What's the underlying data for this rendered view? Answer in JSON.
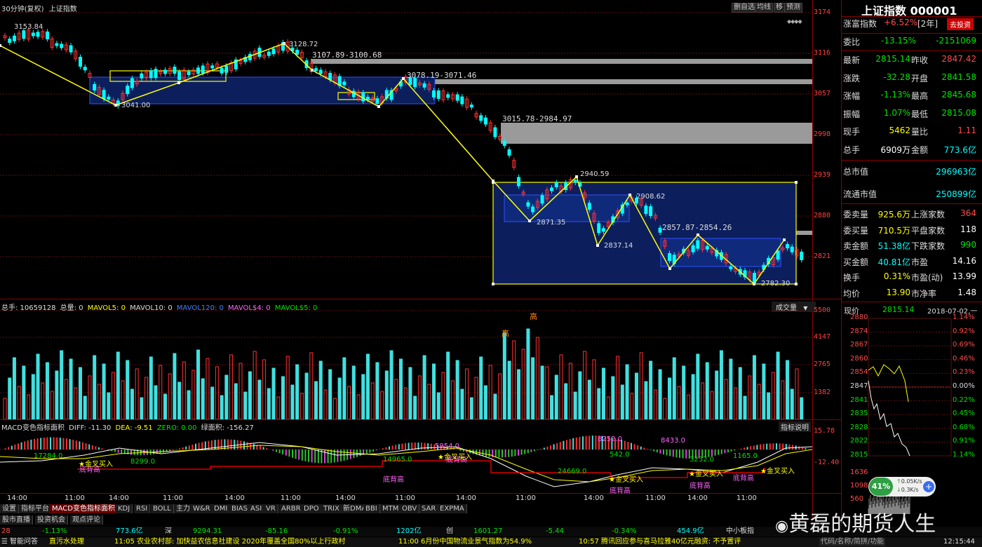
{
  "window": {
    "title_left": "30分钟(复权)",
    "title_index": "上证指数"
  },
  "toolbar": {
    "b1": "删自选",
    "b2": "均线",
    "b3": "移",
    "b4": "预测"
  },
  "price_axis": [
    "3174",
    "3116",
    "3057",
    "2998",
    "2939",
    "2880",
    "2821"
  ],
  "vol_axis": [
    "5500",
    "4147",
    "2765",
    "1382"
  ],
  "macd_axis": [
    "15.78",
    "-12.40"
  ],
  "time_axis": [
    "14:00",
    "11:00",
    "14:00",
    "11:00",
    "14:00",
    "11:00",
    "14:00",
    "11:00",
    "14:00",
    "11:00",
    "14:00",
    "11:00",
    "14:00",
    "11:00"
  ],
  "annotations": {
    "a1": "3153.84",
    "a2": "3041.00",
    "a3": "3128.72",
    "a4": "3107.89-3100.68",
    "a5": "3078.19-3071.46",
    "a6": "3015.78-2984.97",
    "a7": "2940.59",
    "a8": "2871.35",
    "a9": "2908.62",
    "a10": "2837.14",
    "a11": "2857.87-2854.26",
    "a12": "2782.30"
  },
  "vol_header": {
    "total": "总手: 10659128",
    "z": "总量: 0",
    "m5": "MAVOL5: 0",
    "m10": "MAVOL10: 0",
    "m120": "MAVOL120: 0",
    "m4": "MAVOL$4: 0",
    "m5b": "MAVOL$5: 0",
    "right": "成交量"
  },
  "vol_marks": {
    "h1": "高",
    "h2": "高"
  },
  "macd_header": {
    "title": "MACD变色指标面积",
    "diff": "DIFF: -11.30",
    "dea": "DEA: -9.51",
    "zero": "ZERO: 0.00",
    "area": "绿面积: -156.27",
    "right": "指标说明"
  },
  "macd_labels": {
    "l1": "17284.0",
    "l2": "8299.0",
    "l3": "14965.0",
    "l4": "5954.0",
    "l5": "24669.0",
    "l6": "8252.0",
    "l7": "542.0",
    "l8": "8433.0",
    "l9": "3232.0",
    "l10": "1165.0",
    "l11": "底背高",
    "l12": "底背高",
    "l13": "底背高",
    "l14": "底背高",
    "l15": "底背高",
    "l16": "底背高",
    "g1": "金叉买入",
    "g2": "金叉买入",
    "g3": "金叉买入",
    "g4": "金叉买入",
    "g5": "金叉买入"
  },
  "tabs": [
    "设置",
    "指标平台",
    "MACD变色指标面积",
    "KDJ",
    "RSI",
    "BOLL",
    "主力",
    "W&R",
    "DMI",
    "BIAS",
    "ASI",
    "VR",
    "ARBR",
    "DPO",
    "TRIX",
    "新DMA",
    "BBI",
    "MTM",
    "OBV",
    "SAR",
    "EXPMA"
  ],
  "subtabs": [
    "股市直播",
    "投资机会",
    "观点评论"
  ],
  "sidebar": {
    "title": "上证指数 000001",
    "r0": {
      "l": "涨富指数",
      "v": "+6.52%",
      "v2": "[2年]",
      "btn": "去投资"
    },
    "r1": {
      "l": "委比",
      "v": "-13.15%",
      "v2": "-2151069"
    },
    "rows": [
      {
        "l": "最新",
        "v": "2815.14",
        "l2": "昨收",
        "v2": "2847.42",
        "c": "green",
        "c2": ""
      },
      {
        "l": "涨跌",
        "v": "-32.28",
        "l2": "开盘",
        "v2": "2841.58",
        "c": "green",
        "c2": "green"
      },
      {
        "l": "涨幅",
        "v": "-1.13%",
        "l2": "最高",
        "v2": "2845.68",
        "c": "green",
        "c2": "green"
      },
      {
        "l": "振幅",
        "v": "1.07%",
        "l2": "最低",
        "v2": "2815.08",
        "c": "green",
        "c2": "green"
      },
      {
        "l": "现手",
        "v": "5462",
        "l2": "量比",
        "v2": "1.11",
        "c": "yellowc",
        "c2": ""
      },
      {
        "l": "总手",
        "v": "6909万",
        "l2": "金额",
        "v2": "773.6亿",
        "c": "white",
        "c2": "cyanc"
      }
    ],
    "cap1": {
      "l": "总市值",
      "v": "296963亿"
    },
    "cap2": {
      "l": "流通市值",
      "v": "250899亿"
    },
    "rows2": [
      {
        "l": "委卖量",
        "v": "925.6万",
        "l2": "上涨家数",
        "v2": "364",
        "c": "yellowc",
        "c2": ""
      },
      {
        "l": "委买量",
        "v": "710.5万",
        "l2": "平盘家数",
        "v2": "118",
        "c": "yellowc",
        "c2": "white"
      },
      {
        "l": "卖金额",
        "v": "51.38亿",
        "l2": "下跌家数",
        "v2": "990",
        "c": "cyanc",
        "c2": "green"
      },
      {
        "l": "买金额",
        "v": "40.81亿",
        "l2": "市盈",
        "v2": "14.16",
        "c": "cyanc",
        "c2": "white"
      },
      {
        "l": "换手",
        "v": "0.31%",
        "l2": "市盈(动)",
        "v2": "13.99",
        "c": "yellowc",
        "c2": "white"
      },
      {
        "l": "均价",
        "v": "13.90",
        "l2": "市净率",
        "v2": "1.48",
        "c": "yellowc",
        "c2": "white"
      }
    ],
    "mini": {
      "l": "现价",
      "v": "2815.14",
      "date": "2018-07-02,一",
      "prices": [
        "2880",
        "2874",
        "2867",
        "2860",
        "2854",
        "2847",
        "2841",
        "2835",
        "2828",
        "2822",
        "2815"
      ],
      "pcts": [
        "1.14%",
        "0.92%",
        "0.69%",
        "0.46%",
        "0.23%",
        "0.00%",
        "0.22%",
        "0.45%",
        "0.68%",
        "0.91%",
        "1.14%"
      ],
      "vols": [
        "1636",
        "1098",
        "560"
      ],
      "speed": "41%",
      "up": "0.05K/s",
      "down": "0.3K/s"
    }
  },
  "bottom": {
    "sh_val": "-1.13%",
    "sh_amt": "773.6亿",
    "sz_label": "深",
    "sz_idx": "9294.31",
    "sz_chg": "-85.16",
    "sz_pct": "-0.91%",
    "sz_amt": "1202亿",
    "cy_label": "创",
    "cy_idx": "1601.27",
    "cy_chg": "-5.44",
    "cy_pct": "-0.34%",
    "cy_amt": "454.9亿",
    "zx": "中小板指",
    "left_pref": "28",
    "n1": "智能问答",
    "n2": "直污水处理",
    "n3": "11:05 农业农村部: 加快益农信息社建设 2020年覆盖全国80%以上行政村",
    "n4": "11:00 6月份中国物流业景气指数为54.9%",
    "n5": "10:57 腾讯回应参与喜马拉雅40亿元融资: 不予置评",
    "r1": "代码/名称/简拼/功能",
    "r2": "12:15:44"
  },
  "watermark": "黄磊的期货人生",
  "chart_data": {
    "type": "candlestick",
    "title": "上证指数",
    "ylim": [
      2780,
      3174
    ],
    "annotated_levels": [
      3153.84,
      3041.0,
      3128.72,
      3078.19,
      3015.78,
      2940.59,
      2908.62,
      2871.35,
      2837.14,
      2857.87,
      2782.3
    ],
    "zigzag": [
      3140,
      3041,
      3128,
      3065,
      3080,
      2930,
      2872,
      2940,
      2837,
      2908,
      2815,
      2855,
      2782,
      2845
    ]
  }
}
